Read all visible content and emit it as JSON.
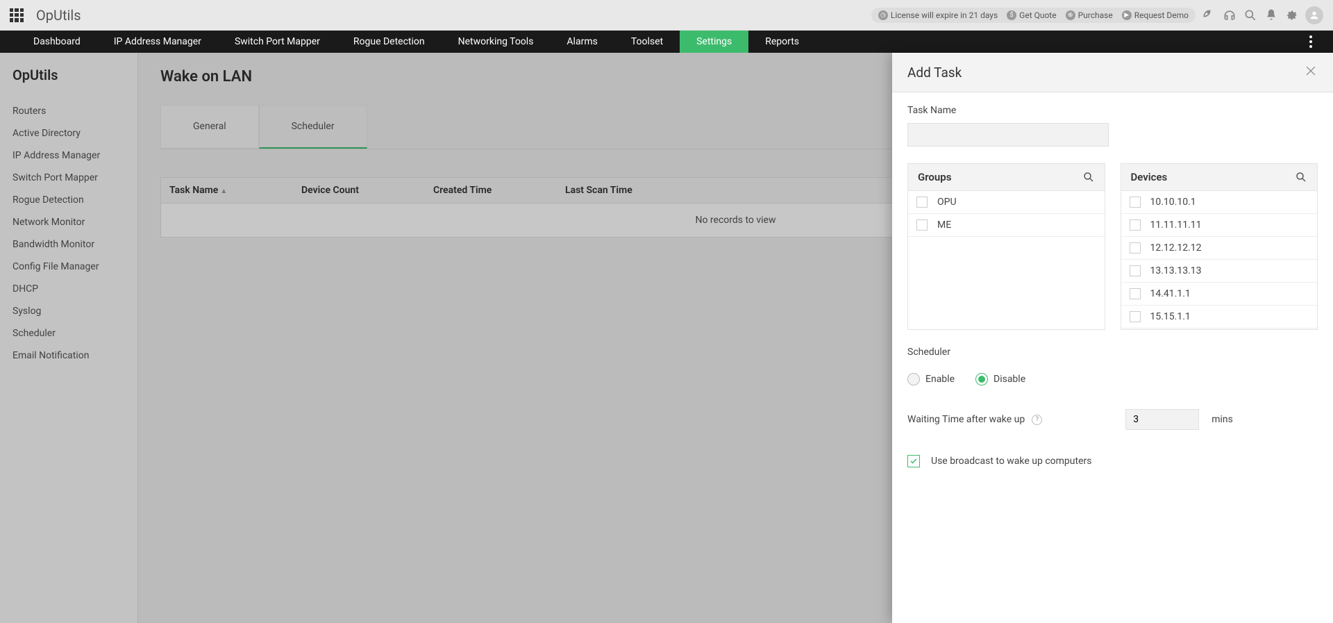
{
  "brand": "OpUtils",
  "licenseBar": {
    "expire": "License will expire in 21 days",
    "quote": "Get Quote",
    "purchase": "Purchase",
    "demo": "Request Demo"
  },
  "nav": [
    "Dashboard",
    "IP Address Manager",
    "Switch Port Mapper",
    "Rogue Detection",
    "Networking Tools",
    "Alarms",
    "Toolset",
    "Settings",
    "Reports"
  ],
  "navActive": "Settings",
  "sidebar": {
    "title": "OpUtils",
    "items": [
      "Routers",
      "Active Directory",
      "IP Address Manager",
      "Switch Port Mapper",
      "Rogue Detection",
      "Network Monitor",
      "Bandwidth Monitor",
      "Config File Manager",
      "DHCP",
      "Syslog",
      "Scheduler",
      "Email Notification"
    ]
  },
  "page": {
    "title": "Wake on LAN",
    "tabs": [
      "General",
      "Scheduler"
    ],
    "activeTab": "Scheduler",
    "columns": [
      "Task Name",
      "Device Count",
      "Created Time",
      "Last Scan Time"
    ],
    "noRecords": "No records to view"
  },
  "panel": {
    "title": "Add Task",
    "taskNameLabel": "Task Name",
    "taskNameValue": "",
    "groupsLabel": "Groups",
    "groups": [
      "OPU",
      "ME"
    ],
    "devicesLabel": "Devices",
    "devices": [
      "10.10.10.1",
      "11.11.11.11",
      "12.12.12.12",
      "13.13.13.13",
      "14.41.1.1",
      "15.15.1.1"
    ],
    "schedulerLabel": "Scheduler",
    "enableLabel": "Enable",
    "disableLabel": "Disable",
    "schedulerState": "disable",
    "waitingLabel": "Waiting Time after wake up",
    "waitingValue": "3",
    "minsLabel": "mins",
    "broadcastLabel": "Use broadcast to wake up computers",
    "broadcastChecked": true
  }
}
